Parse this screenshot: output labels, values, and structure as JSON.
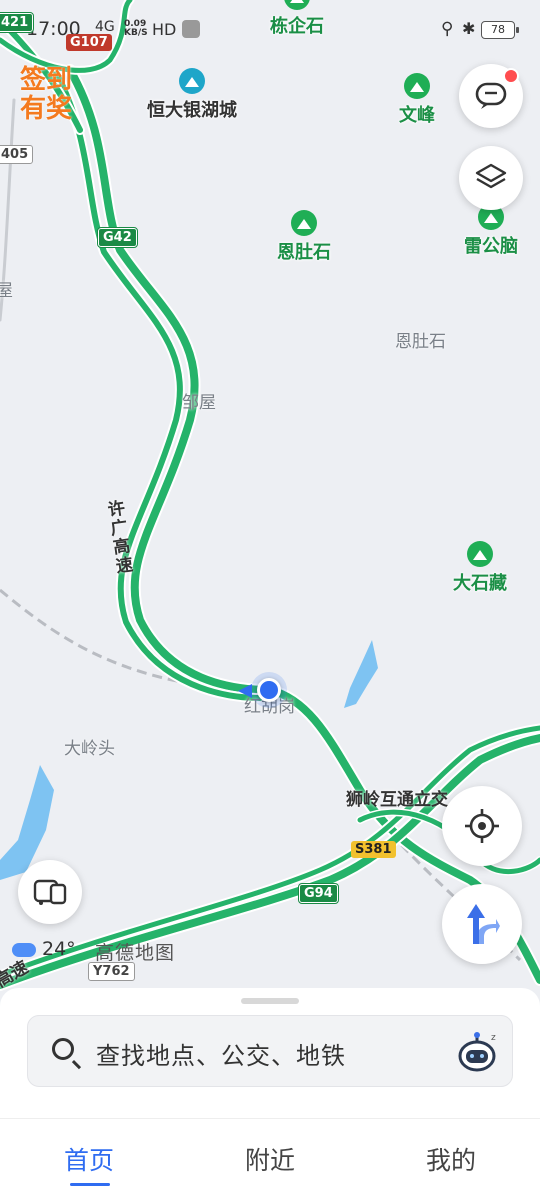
{
  "status_bar": {
    "time": "17:00",
    "network": "4G",
    "speed_value": "0.09",
    "speed_unit": "KB/S",
    "hd": "HD",
    "battery": "78"
  },
  "signin": {
    "line1": "签到",
    "line2": "有奖"
  },
  "pois": [
    {
      "name": "栋企石",
      "color": "green"
    },
    {
      "name": "恒大银湖城",
      "color": "blue"
    },
    {
      "name": "文峰",
      "color": "green"
    },
    {
      "name": "恩肚石",
      "color": "green"
    },
    {
      "name": "雷公脑",
      "color": "green"
    },
    {
      "name": "大石藏",
      "color": "green"
    }
  ],
  "place_labels": [
    "恩肚石",
    "邹屋",
    "大岭头",
    "狮岭互通立交",
    "红胡岗",
    "屋"
  ],
  "road_labels": [
    "许广高速",
    "高速"
  ],
  "route_shields": [
    {
      "code": "421",
      "style": "green"
    },
    {
      "code": "G107",
      "style": "red"
    },
    {
      "code": "405",
      "style": "white"
    },
    {
      "code": "G42",
      "style": "green"
    },
    {
      "code": "S381",
      "style": "yellow"
    },
    {
      "code": "G94",
      "style": "green"
    },
    {
      "code": "Y762",
      "style": "white"
    }
  ],
  "weather": {
    "temp": "24°",
    "icon": "cloud-icon"
  },
  "brand": "高德地图",
  "search": {
    "placeholder": "查找地点、公交、地铁"
  },
  "tabs": [
    {
      "label": "首页",
      "active": true
    },
    {
      "label": "附近",
      "active": false
    },
    {
      "label": "我的",
      "active": false
    }
  ],
  "colors": {
    "accent": "#2f6cf1",
    "highway": "#25b36a",
    "congestion": "#8b1e1e",
    "signin": "#f47a1f"
  }
}
